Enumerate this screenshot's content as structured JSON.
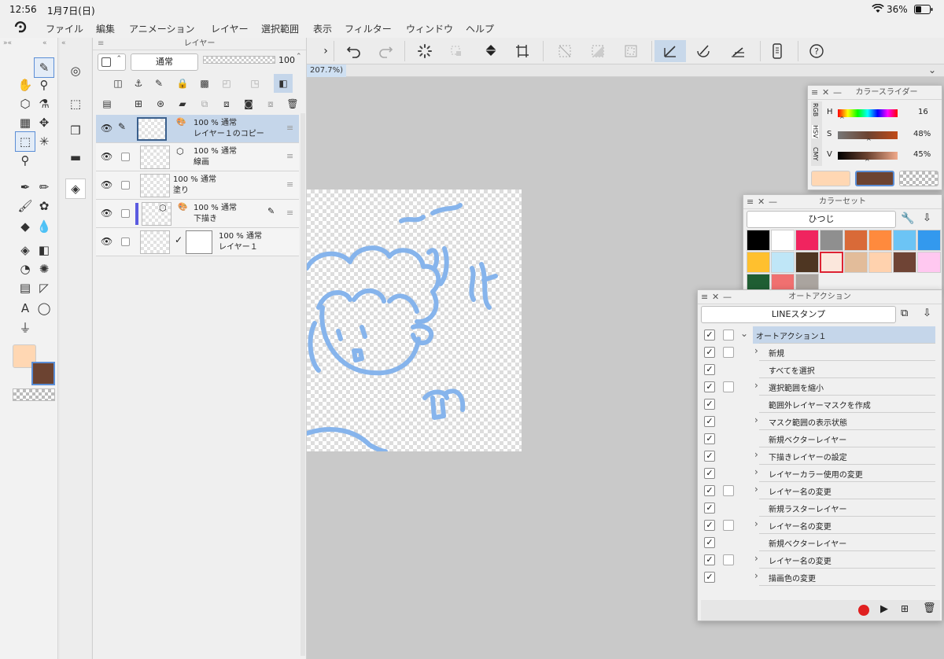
{
  "status": {
    "time": "12:56",
    "date": "1月7日(日)",
    "battery": "36%"
  },
  "menu": [
    "ファイル",
    "編集",
    "アニメーション",
    "レイヤー",
    "選択範囲",
    "表示",
    "フィルター",
    "ウィンドウ",
    "ヘルプ"
  ],
  "tab": {
    "zoom": "207.7%)"
  },
  "layers_panel": {
    "title": "レイヤー",
    "blend_mode": "通常",
    "opacity": "100",
    "layers": [
      {
        "opacity": "100 % 通常",
        "name": "レイヤー１のコピー",
        "selected": true
      },
      {
        "opacity": "100 % 通常",
        "name": "線画",
        "selected": false
      },
      {
        "opacity": "100 % 通常",
        "name": "塗り",
        "selected": false
      },
      {
        "opacity": "100 % 通常",
        "name": "下描き",
        "selected": false
      },
      {
        "opacity": "100 % 通常",
        "name": "レイヤー１",
        "selected": false
      }
    ]
  },
  "color_slider": {
    "title": "カラースライダー",
    "tabs": [
      "RGB",
      "HSV",
      "CMY"
    ],
    "h_label": "H",
    "h_value": "16",
    "s_label": "S",
    "s_value": "48%",
    "v_label": "V",
    "v_value": "45%"
  },
  "color_set": {
    "title": "カラーセット",
    "set_name": "ひつじ",
    "colors": [
      "#000000",
      "#ffffff",
      "#f0245f",
      "#8f8f8f",
      "#d96a38",
      "#ff8a3d",
      "#6cc4f5",
      "#3399ee",
      "#ffc02e",
      "#bfe6f7",
      "#4e3622",
      "#fbe7dc",
      "#e2bc9a",
      "#ffd2ae",
      "#6f4435",
      "#ffc8f0",
      "#1f5e33",
      "#f07070",
      "#aaa49f"
    ]
  },
  "auto_action": {
    "title": "オートアクション",
    "set_name": "LINEスタンプ",
    "items": [
      {
        "label": "オートアクション１",
        "checked": true,
        "has_box": true,
        "expand": "v"
      },
      {
        "label": "新規",
        "checked": true,
        "has_box": true,
        "expand": ">"
      },
      {
        "label": "すべてを選択",
        "checked": true,
        "has_box": false,
        "expand": ""
      },
      {
        "label": "選択範囲を縮小",
        "checked": true,
        "has_box": true,
        "expand": ">"
      },
      {
        "label": "範囲外レイヤーマスクを作成",
        "checked": true,
        "has_box": false,
        "expand": ""
      },
      {
        "label": "マスク範囲の表示状態",
        "checked": true,
        "has_box": false,
        "expand": ">"
      },
      {
        "label": "新規ベクターレイヤー",
        "checked": true,
        "has_box": false,
        "expand": ""
      },
      {
        "label": "下描きレイヤーの設定",
        "checked": true,
        "has_box": false,
        "expand": ">"
      },
      {
        "label": "レイヤーカラー使用の変更",
        "checked": true,
        "has_box": false,
        "expand": ">"
      },
      {
        "label": "レイヤー名の変更",
        "checked": true,
        "has_box": true,
        "expand": ">"
      },
      {
        "label": "新規ラスターレイヤー",
        "checked": true,
        "has_box": false,
        "expand": ""
      },
      {
        "label": "レイヤー名の変更",
        "checked": true,
        "has_box": true,
        "expand": ">"
      },
      {
        "label": "新規ベクターレイヤー",
        "checked": true,
        "has_box": false,
        "expand": ""
      },
      {
        "label": "レイヤー名の変更",
        "checked": true,
        "has_box": true,
        "expand": ">"
      },
      {
        "label": "描画色の変更",
        "checked": true,
        "has_box": false,
        "expand": ">"
      }
    ]
  },
  "colors": {
    "main": "#ffd7b3",
    "sub": "#6c4331",
    "accent": "#5b8ed6",
    "sketch_blue": "#86b4ec"
  },
  "icons": [
    "brush-icon",
    "hand-icon",
    "zoom-icon",
    "eyedropper-icon",
    "fill-icon",
    "undo-icon",
    "redo-icon",
    "record-icon",
    "play-icon",
    "trash-icon"
  ]
}
